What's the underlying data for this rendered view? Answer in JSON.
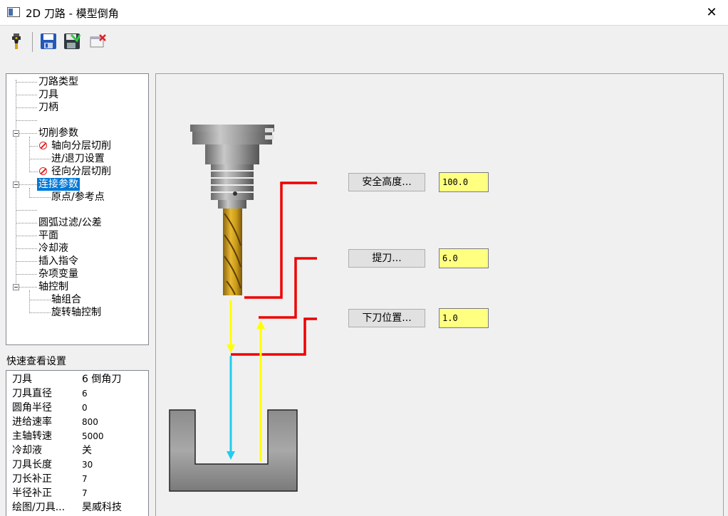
{
  "window": {
    "title": "2D 刀路 - 模型倒角",
    "close_glyph": "✕"
  },
  "toolbar": {
    "items": [
      {
        "name": "tool-icon"
      },
      {
        "name": "save-icon"
      },
      {
        "name": "save-as-icon"
      },
      {
        "name": "cancel-icon"
      }
    ]
  },
  "tree": {
    "items": [
      {
        "label": "刀路类型"
      },
      {
        "label": "刀具"
      },
      {
        "label": "刀柄"
      },
      {
        "label": ""
      },
      {
        "label": "切削参数"
      },
      {
        "label": "轴向分层切削"
      },
      {
        "label": "进/退刀设置"
      },
      {
        "label": "径向分层切削"
      },
      {
        "label": "连接参数"
      },
      {
        "label": "原点/参考点"
      },
      {
        "label": ""
      },
      {
        "label": "圆弧过滤/公差"
      },
      {
        "label": "平面"
      },
      {
        "label": "冷却液"
      },
      {
        "label": "插入指令"
      },
      {
        "label": "杂项变量"
      },
      {
        "label": "轴控制"
      },
      {
        "label": "轴组合"
      },
      {
        "label": "旋转轴控制"
      }
    ],
    "selected": "连接参数"
  },
  "quick_view": {
    "title": "快速查看设置",
    "rows": [
      {
        "label": "刀具",
        "value": "6 倒角刀"
      },
      {
        "label": "刀具直径",
        "value": "6"
      },
      {
        "label": "圆角半径",
        "value": "0"
      },
      {
        "label": "进给速率",
        "value": "800"
      },
      {
        "label": "主轴转速",
        "value": "5000"
      },
      {
        "label": "冷却液",
        "value": "关"
      },
      {
        "label": "刀具长度",
        "value": "30"
      },
      {
        "label": "刀长补正",
        "value": "7"
      },
      {
        "label": "半径补正",
        "value": "7"
      },
      {
        "label": "绘图/刀具...",
        "value": "昊威科技"
      }
    ]
  },
  "params": {
    "clearance": {
      "label": "安全高度...",
      "value": "100.0"
    },
    "retract": {
      "label": "提刀...",
      "value": "6.0"
    },
    "feed_plane": {
      "label": "下刀位置...",
      "value": "1.0"
    }
  },
  "colors": {
    "red_line": "#ee0000",
    "yellow_arrow": "#ffff00",
    "cyan_arrow": "#22ccee",
    "flute_gold": "#c89a1a",
    "input_bg": "#ffff80",
    "selected_bg": "#0078d7"
  }
}
